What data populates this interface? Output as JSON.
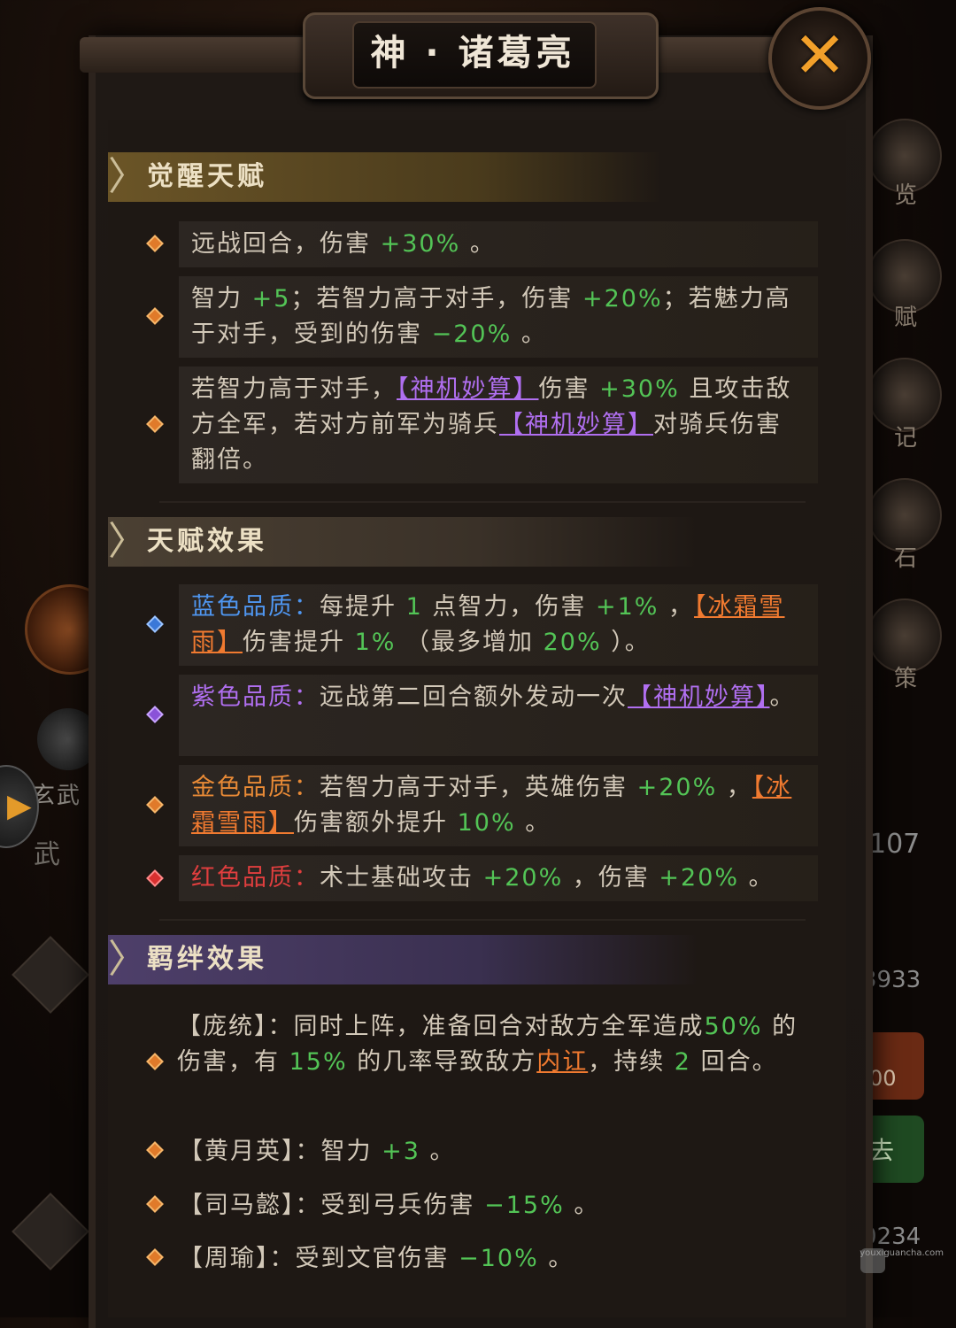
{
  "window": {
    "title": "神 · 诸葛亮",
    "close_label": "✕"
  },
  "background": {
    "left": {
      "label_xuanwu": "玄武",
      "label_wu": "武"
    },
    "right": {
      "items": [
        {
          "label": "览"
        },
        {
          "label": "赋"
        },
        {
          "label": "记"
        },
        {
          "label": "石"
        },
        {
          "label": "策"
        }
      ],
      "num1": "107",
      "num2": "3933",
      "num3": "0234",
      "badge1": "00",
      "badge_go": "去"
    }
  },
  "sections": {
    "awakening": {
      "title": "觉醒天赋",
      "items": [
        {
          "t1": "远战回合，伤害 ",
          "g1": "+30%",
          "t2": " 。"
        },
        {
          "t1": "智力 ",
          "g1": "+5",
          "t2": "；若智力高于对手，伤害 ",
          "g2": "+20%",
          "t3": "；若魅力高于对手，受到的伤害 ",
          "g3": "−20%",
          "t4": " 。"
        },
        {
          "t1": "若智力高于对手，",
          "l1": "【神机妙算】",
          "t2": "伤害 ",
          "g1": "+30%",
          "t3": " 且攻击敌方全军，若对方前军为骑兵",
          "l2": "【神机妙算】",
          "t4": "对骑兵伤害翻倍。"
        }
      ]
    },
    "talent": {
      "title": "天赋效果",
      "items": [
        {
          "q": "蓝色品质：",
          "t1": "每提升 ",
          "g1": "1",
          "t2": " 点智力，伤害 ",
          "g2": "+1%",
          "t3": " ，",
          "l1": "【冰霜雪雨】",
          "t4": "伤害提升 ",
          "g3": "1%",
          "t5": " （最多增加 ",
          "g4": "20%",
          "t6": " ）。"
        },
        {
          "q": "紫色品质：",
          "t1": "远战第二回合额外发动一次",
          "l1": "【神机妙算】",
          "t2": "。"
        },
        {
          "q": "金色品质：",
          "t1": "若智力高于对手，英雄伤害 ",
          "g1": "+20%",
          "t2": " ，",
          "l1": "【冰霜雪雨】",
          "t3": "伤害额外提升 ",
          "g2": "10%",
          "t4": " 。"
        },
        {
          "q": "红色品质：",
          "t1": "术士基础攻击 ",
          "g1": "+20%",
          "t2": " ，伤害 ",
          "g2": "+20%",
          "t3": " 。"
        }
      ]
    },
    "bond": {
      "title": "羁绊效果",
      "items": [
        {
          "name": "【庞统】",
          "t1": "：同时上阵，准备回合对敌方全军造成",
          "g1": "50%",
          "t2": " 的伤害，有 ",
          "g2": "15%",
          "t3": " 的几率导致敌方",
          "l1": "内讧",
          "t4": "，持续 ",
          "g3": "2",
          "t5": " 回合。"
        },
        {
          "name": "【黄月英】",
          "t1": "：智力 ",
          "g1": "+3",
          "t2": " 。"
        },
        {
          "name": "【司马懿】",
          "t1": "：受到弓兵伤害 ",
          "g1": "−15%",
          "t2": " 。"
        },
        {
          "name": "【周瑜】",
          "t1": "：受到文官伤害 ",
          "g1": "−10%",
          "t2": " 。"
        }
      ]
    }
  },
  "watermark": "youxiguancha.com"
}
